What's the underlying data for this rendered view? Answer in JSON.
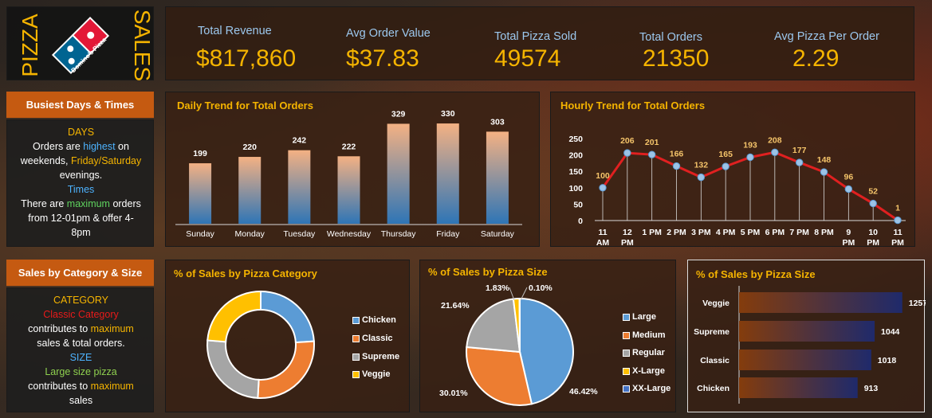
{
  "brand": {
    "word_left": "PIZZA",
    "word_right": "SALES",
    "logo_text": "Domino's Pizza"
  },
  "kpis": [
    {
      "label": "Total Revenue",
      "value": "$817,860"
    },
    {
      "label": "Avg Order Value",
      "value": "$37.83"
    },
    {
      "label": "Total Pizza Sold",
      "value": "49574"
    },
    {
      "label": "Total Orders",
      "value": "21350"
    },
    {
      "label": "Avg Pizza Per Order",
      "value": "2.29"
    }
  ],
  "busiest": {
    "title": "Busiest Days & Times",
    "days_heading": "DAYS",
    "l1a": "Orders are ",
    "l1b": "highest",
    "l1c": " on",
    "l2a": "weekends, ",
    "l2b": "Friday/Saturday",
    "l3": "evenings.",
    "times_heading": "Times",
    "l4a": "There are ",
    "l4b": "maximum",
    "l4c": " orders",
    "l5": "from 12-01pm & offer 4-",
    "l6": "8pm"
  },
  "salescat": {
    "title": "Sales by Category & Size",
    "cat_heading": "CATEGORY",
    "l1": "Classic Category",
    "l2a": "contributes to ",
    "l2b": "maximum",
    "l3": "sales & total orders.",
    "size_heading": "SIZE",
    "l4": "Large size pizza",
    "l5a": "contributes to ",
    "l5b": "maximum",
    "l6": "sales"
  },
  "colors": {
    "accent": "#f5b400",
    "orange": "#c55a11",
    "line": "#e02020",
    "marker": "#9cc3e6",
    "blue_kpi": "#9cc8ee"
  },
  "chart_data": [
    {
      "type": "bar",
      "title": "Daily Trend for Total Orders",
      "categories": [
        "Sunday",
        "Monday",
        "Tuesday",
        "Wednesday",
        "Thursday",
        "Friday",
        "Saturday"
      ],
      "values": [
        199,
        220,
        242,
        222,
        329,
        330,
        303
      ],
      "ylim": [
        0,
        380
      ],
      "grid": false
    },
    {
      "type": "line",
      "title": "Hourly Trend for Total Orders",
      "categories": [
        "11 AM",
        "12 PM",
        "1 PM",
        "2 PM",
        "3 PM",
        "4 PM",
        "5 PM",
        "6 PM",
        "7 PM",
        "8 PM",
        "9 PM",
        "10 PM",
        "11 PM"
      ],
      "values": [
        100,
        206,
        201,
        166,
        132,
        165,
        193,
        208,
        177,
        148,
        96,
        52,
        1
      ],
      "yticks": [
        0,
        50,
        100,
        150,
        200,
        250
      ],
      "ylim": [
        0,
        250
      ],
      "grid": false
    },
    {
      "type": "pie",
      "title": "% of Sales by Pizza Category",
      "labels": [
        "Chicken",
        "Classic",
        "Supreme",
        "Veggie"
      ],
      "values": [
        23.96,
        26.91,
        25.46,
        23.68
      ],
      "colors": [
        "#5b9bd5",
        "#ed7d31",
        "#a5a5a5",
        "#ffc000"
      ],
      "donut": true,
      "legend": "right"
    },
    {
      "type": "pie",
      "title": "% of Sales by Pizza Size",
      "labels": [
        "Large",
        "Medium",
        "Regular",
        "X-Large",
        "XX-Large"
      ],
      "values": [
        46.42,
        30.01,
        21.64,
        1.83,
        0.1
      ],
      "value_labels": [
        "46.42%",
        "30.01%",
        "21.64%",
        "1.83%",
        "0.10%"
      ],
      "colors": [
        "#5b9bd5",
        "#ed7d31",
        "#a5a5a5",
        "#ffc000",
        "#4472c4"
      ],
      "legend": "right"
    },
    {
      "type": "bar",
      "title": "% of Sales by Pizza Size",
      "orientation": "horizontal",
      "categories": [
        "Veggie",
        "Supreme",
        "Classic",
        "Chicken"
      ],
      "values": [
        1257,
        1044,
        1018,
        913
      ],
      "xlim": [
        0,
        1320
      ]
    }
  ]
}
